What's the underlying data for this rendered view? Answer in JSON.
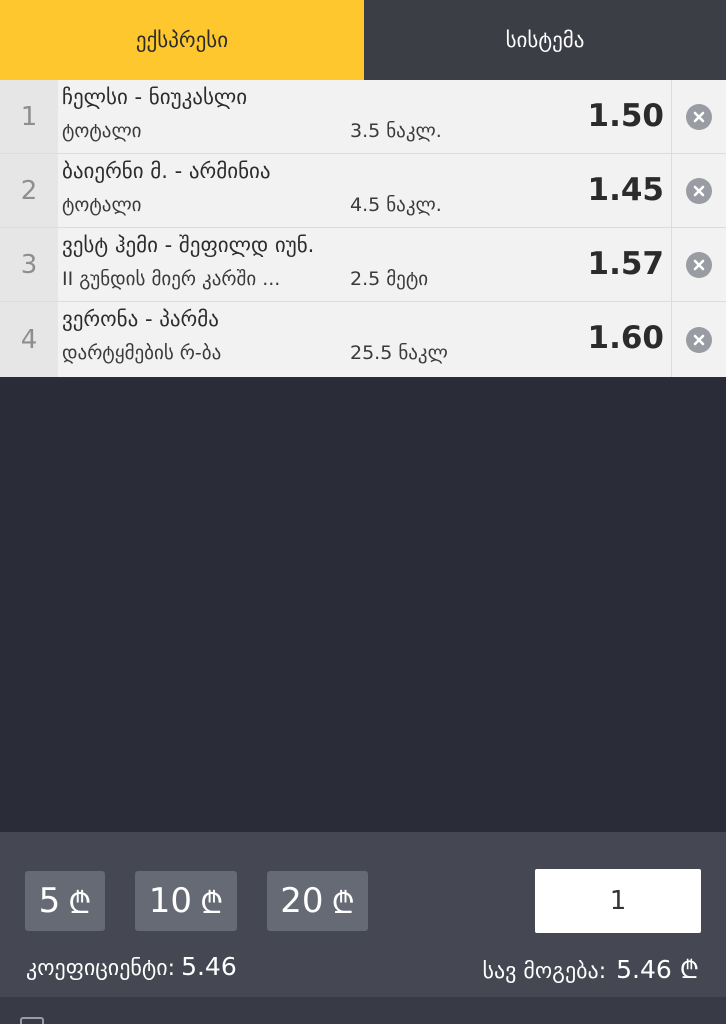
{
  "tabs": {
    "express": "ექსპრესი",
    "system": "სისტემა"
  },
  "bets": [
    {
      "index": "1",
      "match": "ჩელსი - ნიუკასლი",
      "market": "ტოტალი",
      "outcome": "3.5 ნაკლ.",
      "odds": "1.50"
    },
    {
      "index": "2",
      "match": "ბაიერნი მ. - არმინია",
      "market": "ტოტალი",
      "outcome": "4.5 ნაკლ.",
      "odds": "1.45"
    },
    {
      "index": "3",
      "match": "ვესტ ჰემი - შეფილდ იუნ.",
      "market": "II გუნდის მიერ კარში ...",
      "outcome": "2.5 მეტი",
      "odds": "1.57"
    },
    {
      "index": "4",
      "match": "ვერონა - პარმა",
      "market": "დარტყმების რ-ბა",
      "outcome": "25.5 ნაკლ",
      "odds": "1.60"
    }
  ],
  "quick_stakes": [
    {
      "amount": "5",
      "currency": "₾"
    },
    {
      "amount": "10",
      "currency": "₾"
    },
    {
      "amount": "20",
      "currency": "₾"
    }
  ],
  "stake_input": {
    "value": "1"
  },
  "summary": {
    "coef_label": "კოეფიციენტი:",
    "coef_value": "5.46",
    "winning_label": "სავ მოგება:",
    "winning_value": "5.46 ₾"
  },
  "colors": {
    "accent": "#fec72d",
    "background": "#2a2d38"
  }
}
